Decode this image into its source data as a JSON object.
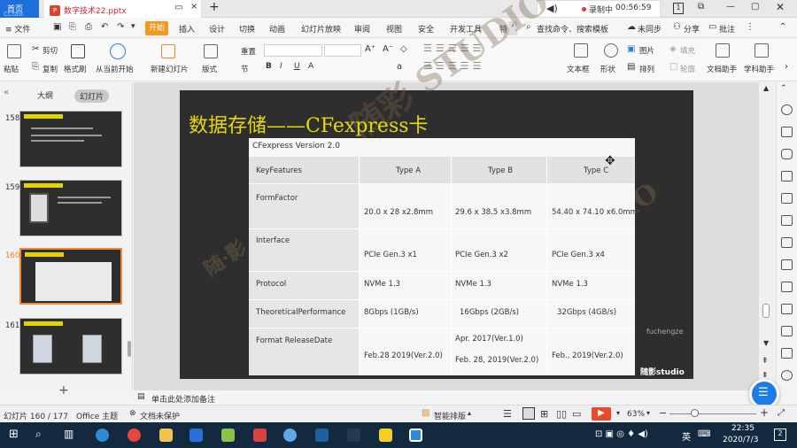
{
  "tabs": {
    "home": "首页",
    "doc": "数字技术22.pptx",
    "brand": "CCtalk"
  },
  "recording": {
    "label": "录制中",
    "time": "00:56:59",
    "badge": "1"
  },
  "ribbon": {
    "file": "≡ 文件",
    "start": "开始",
    "items": [
      "插入",
      "设计",
      "切换",
      "动画",
      "幻灯片放映",
      "审阅",
      "视图",
      "安全",
      "开发工具",
      "特"
    ],
    "search": "查找命令、搜索模板",
    "sync": "未同步",
    "share": "分享",
    "comment": "批注"
  },
  "toolbar": {
    "paste": "粘贴",
    "cut": "剪切",
    "copy": "复制",
    "format": "格式刷",
    "from_current": "从当前开始",
    "new_slide": "新建幻灯片",
    "layout": "版式",
    "section": "节",
    "reset": "重置",
    "textbox": "文本框",
    "shape": "形状",
    "arrange": "排列",
    "picture": "图片",
    "fill": "填充",
    "outline": "轮廓",
    "doc_helper": "文档助手",
    "academic_helper": "学科助手"
  },
  "sidebar": {
    "tab_outline": "大纲",
    "tab_slides": "幻灯片",
    "slides": [
      {
        "num": "158"
      },
      {
        "num": "159"
      },
      {
        "num": "160"
      },
      {
        "num": "161"
      }
    ],
    "add": "+"
  },
  "slide": {
    "title": "数据存储——CFexpress卡",
    "watermark_a": "随彩 STUDIO",
    "watermark_b": "随·影",
    "author": "fuchengze",
    "brand": "随影studio",
    "table": {
      "caption": "CFexpress Version 2.0",
      "headers": [
        "KeyFeatures",
        "Type A",
        "Type B",
        "Type C"
      ],
      "rows": [
        {
          "label": "FormFactor",
          "a": "20.0 x 28 x2.8mm",
          "b": "29.6 x 38.5 x3.8mm",
          "c": "54.40 x 74.10 x6.0mm"
        },
        {
          "label": "Interface",
          "a": "PCIe Gen.3 x1",
          "b": "PCIe Gen.3 x2",
          "c": "PCIe Gen.3 x4"
        },
        {
          "label": "Protocol",
          "a": "NVMe 1.3",
          "b": "NVMe 1.3",
          "c": "NVMe 1.3"
        },
        {
          "label": "TheoreticalPerformance",
          "a": "8Gbps (1GB/s)",
          "b": "16Gbps (2GB/s)",
          "c": "32Gbps (4GB/s)"
        },
        {
          "label": "Format ReleaseDate",
          "a": "Feb.28 2019(Ver.2.0)",
          "b1": "Apr. 2017(Ver.1.0)",
          "b2": "Feb. 28, 2019(Ver.2.0)",
          "c": "Feb., 2019(Ver.2.0)"
        }
      ]
    }
  },
  "notes": {
    "placeholder": "单击此处添加备注"
  },
  "status": {
    "slide_info": "幻灯片 160 / 177",
    "theme": "Office 主题",
    "protect": "文档未保护",
    "smart": "智能排版",
    "zoom": "63%"
  },
  "taskbar": {
    "time": "22:35",
    "date": "2020/7/3",
    "lang": "英",
    "notif": "2"
  },
  "colors": {
    "accent": "#f29a1f",
    "title_yellow": "#e8d90a",
    "play_red": "#e84b2c"
  }
}
